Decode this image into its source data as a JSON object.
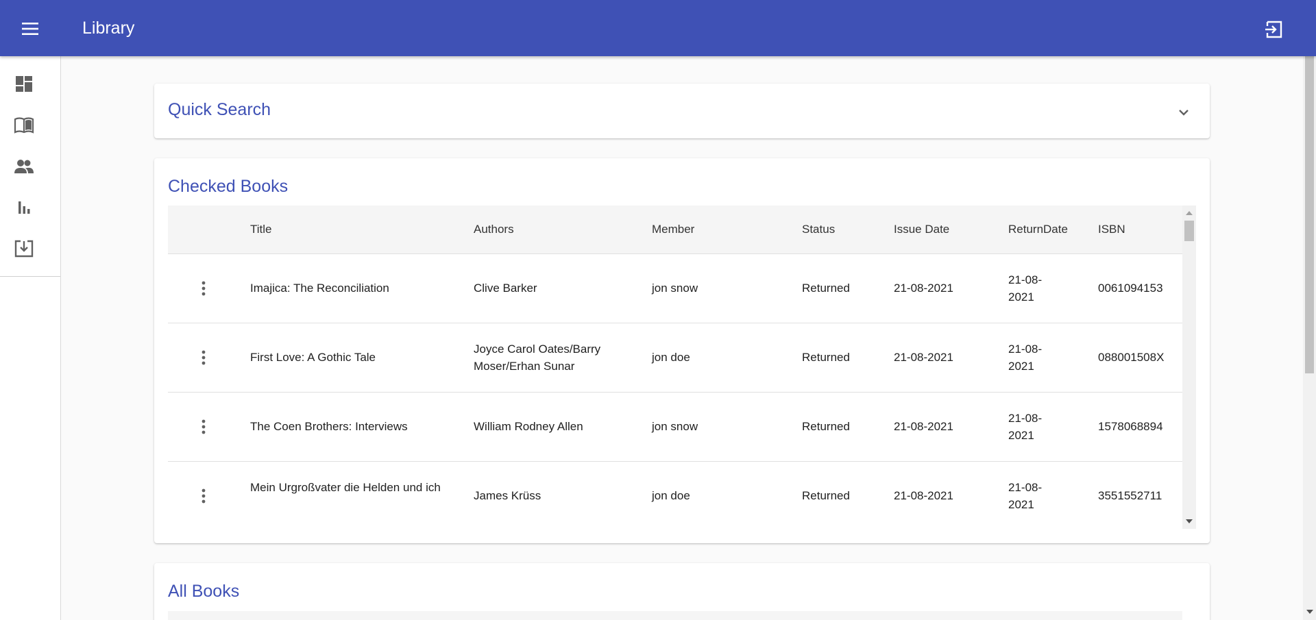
{
  "app": {
    "title": "Library"
  },
  "colors": {
    "primary": "#3f51b5",
    "background": "#fafafa",
    "table_header": "#f5f5f5"
  },
  "appbar": {
    "menu_icon": "menu-icon",
    "logout_icon": "logout-icon"
  },
  "sidebar": {
    "items": [
      {
        "icon": "dashboard-icon"
      },
      {
        "icon": "book-icon"
      },
      {
        "icon": "people-icon"
      },
      {
        "icon": "bar-chart-icon"
      },
      {
        "icon": "download-icon"
      }
    ]
  },
  "quick_search": {
    "title": "Quick Search",
    "expand_icon": "chevron-down-icon"
  },
  "checked_books": {
    "title": "Checked Books",
    "columns": [
      "Title",
      "Authors",
      "Member",
      "Status",
      "Issue Date",
      "ReturnDate",
      "ISBN"
    ],
    "rows": [
      {
        "title": "Imajica: The Reconciliation",
        "authors": "Clive Barker",
        "member": "jon snow",
        "status": "Returned",
        "issue_date": "21-08-2021",
        "return_date": "21-08-2021",
        "isbn": "0061094153"
      },
      {
        "title": "First Love: A Gothic Tale",
        "authors": "Joyce Carol Oates/Barry Moser/Erhan Sunar",
        "member": "jon doe",
        "status": "Returned",
        "issue_date": "21-08-2021",
        "return_date": "21-08-2021",
        "isbn": "088001508X"
      },
      {
        "title": "The Coen Brothers: Interviews",
        "authors": "William Rodney Allen",
        "member": "jon snow",
        "status": "Returned",
        "issue_date": "21-08-2021",
        "return_date": "21-08-2021",
        "isbn": "1578068894"
      },
      {
        "title": "Mein Urgroßvater die Helden und ich",
        "authors": "James Krüss",
        "member": "jon doe",
        "status": "Returned",
        "issue_date": "21-08-2021",
        "return_date": "21-08-2021",
        "isbn": "3551552711"
      }
    ]
  },
  "all_books": {
    "title": "All Books"
  }
}
